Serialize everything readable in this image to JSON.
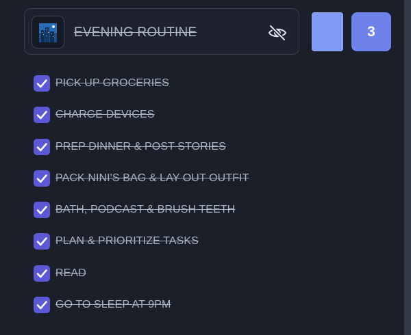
{
  "routine": {
    "title": "EVENING ROUTINE",
    "thumbnail_icon": "city-night-icon",
    "visibility_icon": "eye-off-icon"
  },
  "swatch": {
    "color": "#7e9af2"
  },
  "count_badge": {
    "value": "3",
    "color": "#6e82ea"
  },
  "accent_colors": {
    "checkbox": "#5b59d6",
    "background": "#1b1f2a"
  },
  "tasks": [
    {
      "label": "PICK UP GROCERIES",
      "checked": true
    },
    {
      "label": "CHARGE DEVICES",
      "checked": true
    },
    {
      "label": "PREP DINNER & POST STORIES",
      "checked": true
    },
    {
      "label": "PACK NINI'S BAG & LAY OUT OUTFIT",
      "checked": true
    },
    {
      "label": "BATH, PODCAST & BRUSH TEETH",
      "checked": true
    },
    {
      "label": "PLAN & PRIORITIZE TASKS",
      "checked": true
    },
    {
      "label": "READ",
      "checked": true
    },
    {
      "label": "GO TO SLEEP AT 9PM",
      "checked": true
    }
  ]
}
